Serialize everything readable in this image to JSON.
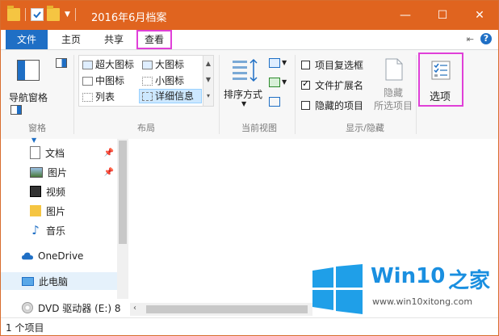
{
  "window": {
    "title": "2016年6月档案",
    "minimize": "—",
    "maximize": "☐",
    "close": "✕"
  },
  "tabs": {
    "file": "文件",
    "home": "主页",
    "share": "共享",
    "view": "查看"
  },
  "ribbon": {
    "pane": {
      "nav_pane": "导航窗格",
      "group": "窗格"
    },
    "layout": {
      "extra_large": "超大图标",
      "large": "大图标",
      "medium": "中图标",
      "small": "小图标",
      "list": "列表",
      "details": "详细信息",
      "group": "布局"
    },
    "current_view": {
      "sort": "排序方式",
      "group": "当前视图"
    },
    "show_hide": {
      "item_checkbox": "项目复选框",
      "file_ext": "文件扩展名",
      "hidden_items": "隐藏的项目",
      "hide": "隐藏",
      "selected_items": "所选项目",
      "group": "显示/隐藏",
      "item_checkbox_checked": false,
      "file_ext_checked": true,
      "hidden_items_checked": false
    },
    "options": "选项"
  },
  "nav": {
    "items": [
      {
        "label": "文档"
      },
      {
        "label": "图片"
      },
      {
        "label": "视频"
      },
      {
        "label": "图片"
      },
      {
        "label": "音乐"
      },
      {
        "label": "OneDrive"
      },
      {
        "label": "此电脑"
      },
      {
        "label": "DVD 驱动器 (E:) 8"
      }
    ]
  },
  "status": {
    "count": "1 个项目"
  },
  "watermark": {
    "brand": "Win10",
    "brand2": "之家",
    "url": "www.win10xitong.com"
  },
  "colors": {
    "titlebar": "#e0641f",
    "accent": "#1f6fc5",
    "highlight": "#e040d8"
  }
}
